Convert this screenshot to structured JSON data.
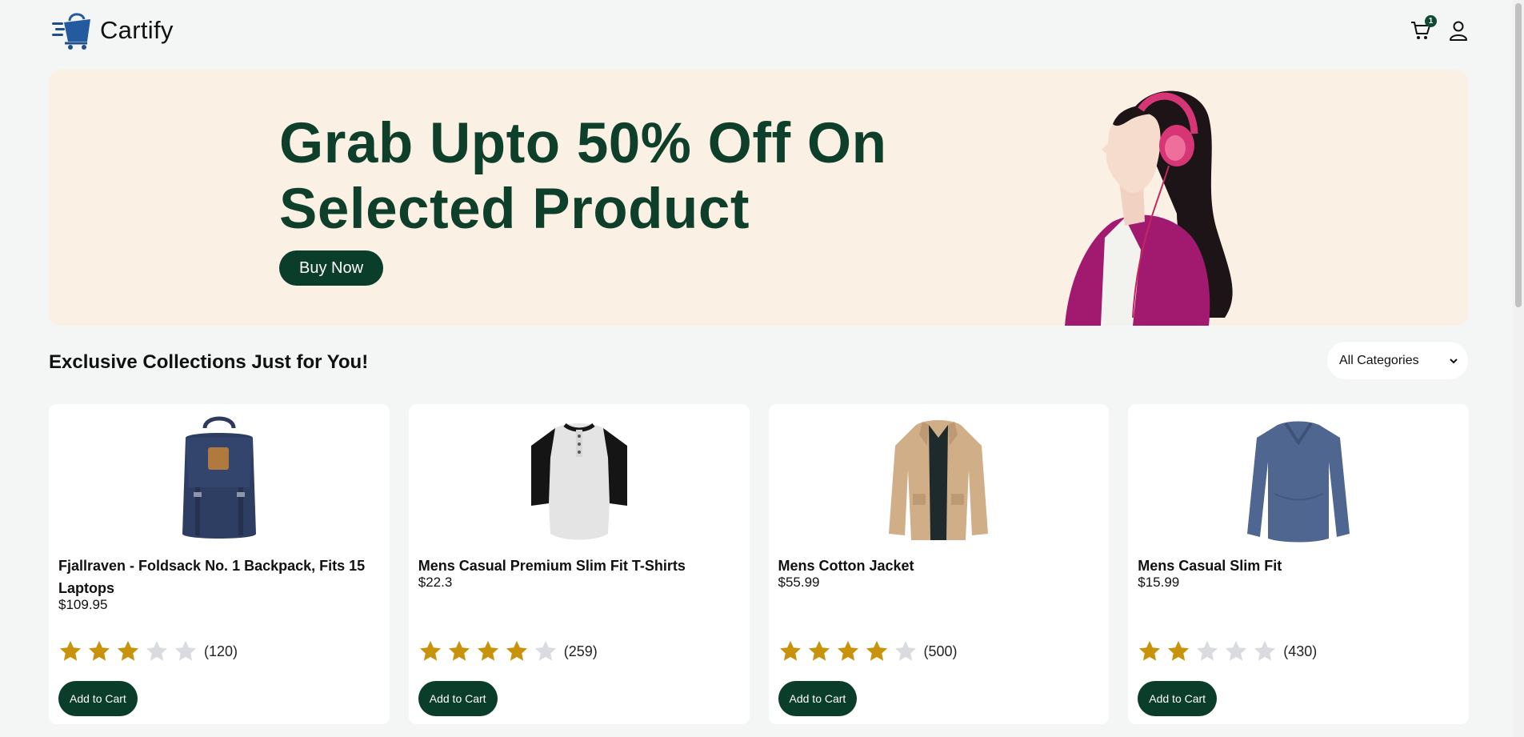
{
  "header": {
    "brand": "Cartify",
    "cart_count": "1"
  },
  "hero": {
    "title_line1": "Grab Upto 50% Off On",
    "title_line2": "Selected Product",
    "cta_label": "Buy Now"
  },
  "section": {
    "title": "Exclusive Collections Just for You!",
    "category_select": "All Categories"
  },
  "products": [
    {
      "title": "Fjallraven - Foldsack No. 1 Backpack, Fits 15 Laptops",
      "price": "$109.95",
      "rating": 3,
      "count": "(120)",
      "button": "Add to Cart",
      "image": "backpack-icon"
    },
    {
      "title": "Mens Casual Premium Slim Fit T-Shirts",
      "price": "$22.3",
      "rating": 4,
      "count": "(259)",
      "button": "Add to Cart",
      "image": "tshirt-icon"
    },
    {
      "title": "Mens Cotton Jacket",
      "price": "$55.99",
      "rating": 4,
      "count": "(500)",
      "button": "Add to Cart",
      "image": "jacket-icon"
    },
    {
      "title": "Mens Casual Slim Fit",
      "price": "$15.99",
      "rating": 2,
      "count": "(430)",
      "button": "Add to Cart",
      "image": "longsleeve-icon"
    }
  ],
  "colors": {
    "primary": "#0a3d2a",
    "hero_bg": "#fbf0e4",
    "star_filled": "#c8920b",
    "star_empty": "#d9dbe0"
  }
}
